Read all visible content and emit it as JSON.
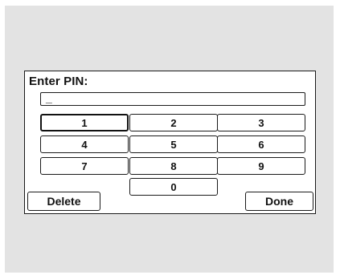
{
  "dialog": {
    "title": "Enter PIN:",
    "pin_value": "_"
  },
  "keypad": {
    "keys": [
      "1",
      "2",
      "3",
      "4",
      "5",
      "6",
      "7",
      "8",
      "9",
      "0"
    ],
    "selected_key": "1"
  },
  "actions": {
    "delete_label": "Delete",
    "done_label": "Done"
  }
}
